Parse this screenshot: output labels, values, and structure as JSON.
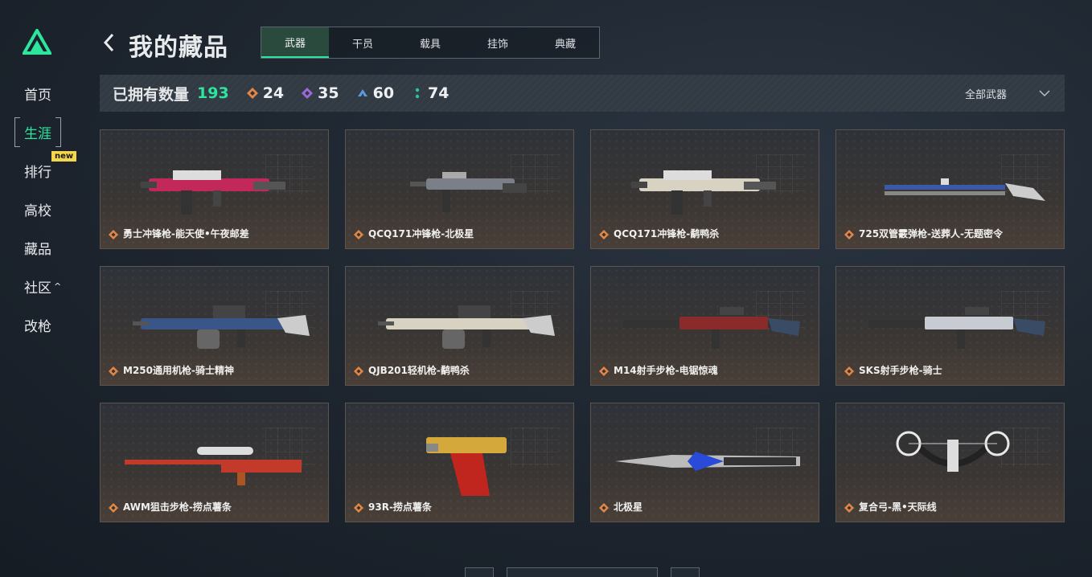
{
  "header": {
    "title": "我的藏品"
  },
  "sidebar": {
    "items": [
      {
        "label": "首页"
      },
      {
        "label": "生涯",
        "active": true
      },
      {
        "label": "排行",
        "badge": "new"
      },
      {
        "label": "高校"
      },
      {
        "label": "藏品"
      },
      {
        "label": "社区",
        "caret": "^"
      },
      {
        "label": "改枪"
      }
    ]
  },
  "tabs": [
    {
      "label": "武器",
      "active": true
    },
    {
      "label": "干员"
    },
    {
      "label": "载具"
    },
    {
      "label": "挂饰"
    },
    {
      "label": "典藏"
    }
  ],
  "stats": {
    "owned_label": "已拥有数量",
    "owned_count": "193",
    "items": [
      {
        "value": "24",
        "icon": "orange-diamond-icon",
        "color": "#e0874a"
      },
      {
        "value": "35",
        "icon": "purple-diamond-icon",
        "color": "#9b6ad8"
      },
      {
        "value": "60",
        "icon": "blue-chevron-icon",
        "color": "#5a9be0"
      },
      {
        "value": "74",
        "icon": "green-colon-icon",
        "color": "#2ec39a"
      }
    ],
    "filter": {
      "label": "全部武器"
    }
  },
  "cards": [
    {
      "name": "勇士冲锋枪-能天使•午夜邮差",
      "art": "smg",
      "color": "#c2285a"
    },
    {
      "name": "QCQ171冲锋枪-北极星",
      "art": "smg-small",
      "color": "#7a7f88"
    },
    {
      "name": "QCQ171冲锋枪-鹬鸭杀",
      "art": "smg",
      "color": "#d8d2c2"
    },
    {
      "name": "725双管霰弹枪-送葬人-无题密令",
      "art": "shotgun",
      "color": "#3a5aa8"
    },
    {
      "name": "M250通用机枪-骑士精神",
      "art": "lmg",
      "color": "#3a5688"
    },
    {
      "name": "QJB201轻机枪-鹬鸭杀",
      "art": "lmg",
      "color": "#d8d2c2"
    },
    {
      "name": "M14射手步枪-电锯惊魂",
      "art": "rifle",
      "color": "#8a2a2a"
    },
    {
      "name": "SKS射手步枪-骑士",
      "art": "rifle",
      "color": "#c8ccd2"
    },
    {
      "name": "AWM狙击步枪-捞点薯条",
      "art": "sniper",
      "color": "#c43a2a"
    },
    {
      "name": "93R-捞点薯条",
      "art": "pistol",
      "color": "#d4a83a"
    },
    {
      "name": "北极星",
      "art": "knife",
      "color": "#2a4ad8"
    },
    {
      "name": "复合弓-黑•天际线",
      "art": "bow",
      "color": "#e8e8e8"
    }
  ]
}
